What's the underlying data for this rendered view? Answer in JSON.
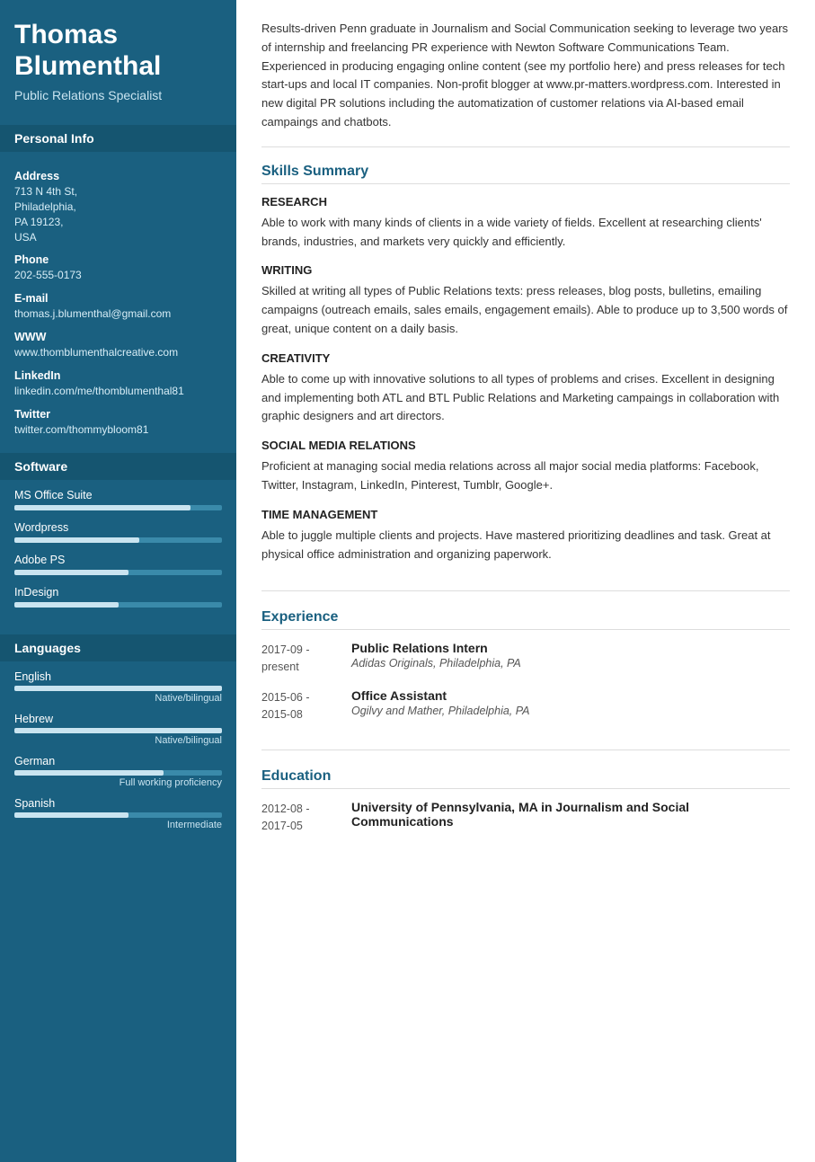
{
  "sidebar": {
    "name": "Thomas Blumenthal",
    "title": "Public Relations Specialist",
    "sections": {
      "personal_info": {
        "label": "Personal Info",
        "fields": [
          {
            "label": "Address",
            "value": "713 N 4th St,\nPhiladelphia,\nPA 19123,\nUSA"
          },
          {
            "label": "Phone",
            "value": "202-555-0173"
          },
          {
            "label": "E-mail",
            "value": "thomas.j.blumenthal@gmail.com"
          },
          {
            "label": "WWW",
            "value": "www.thomblumenthalcreative.com"
          },
          {
            "label": "LinkedIn",
            "value": "linkedin.com/me/thomblumenthal81"
          },
          {
            "label": "Twitter",
            "value": "twitter.com/thommybloom81"
          }
        ]
      },
      "software": {
        "label": "Software",
        "items": [
          {
            "name": "MS Office Suite",
            "pct": 85
          },
          {
            "name": "Wordpress",
            "pct": 60
          },
          {
            "name": "Adobe PS",
            "pct": 55
          },
          {
            "name": "InDesign",
            "pct": 50
          }
        ]
      },
      "languages": {
        "label": "Languages",
        "items": [
          {
            "name": "English",
            "pct": 100,
            "level": "Native/bilingual"
          },
          {
            "name": "Hebrew",
            "pct": 100,
            "level": "Native/bilingual"
          },
          {
            "name": "German",
            "pct": 72,
            "level": "Full working proficiency"
          },
          {
            "name": "Spanish",
            "pct": 55,
            "level": "Intermediate"
          }
        ]
      }
    }
  },
  "main": {
    "summary": "Results-driven Penn graduate in Journalism and Social Communication seeking to leverage two years of internship and freelancing PR experience with Newton Software Communications Team. Experienced in producing engaging online content (see my portfolio here) and press releases for tech start-ups and local IT companies. Non-profit blogger at www.pr-matters.wordpress.com. Interested in new digital PR solutions including the automatization of customer relations via AI-based email campaings and chatbots.",
    "skills_section_title": "Skills Summary",
    "skills": [
      {
        "name": "RESEARCH",
        "desc": "Able to work with many kinds of clients in a wide variety of fields. Excellent at researching clients' brands, industries, and markets very quickly and efficiently."
      },
      {
        "name": "WRITING",
        "desc": "Skilled at writing all types of Public Relations texts: press releases, blog posts, bulletins, emailing campaigns (outreach emails, sales emails, engagement emails). Able to produce up to 3,500 words of great, unique content on a daily basis."
      },
      {
        "name": "CREATIVITY",
        "desc": "Able to come up with innovative solutions to all types of problems and crises. Excellent in designing and implementing both ATL and BTL Public Relations and Marketing campaings in collaboration with graphic designers and art directors."
      },
      {
        "name": "SOCIAL MEDIA RELATIONS",
        "desc": "Proficient at managing social media relations across all major social media platforms: Facebook, Twitter, Instagram, LinkedIn, Pinterest, Tumblr, Google+."
      },
      {
        "name": "TIME MANAGEMENT",
        "desc": "Able to juggle multiple clients and projects. Have mastered prioritizing deadlines and task. Great at physical office administration and organizing paperwork."
      }
    ],
    "experience_section_title": "Experience",
    "experience": [
      {
        "date": "2017-09 - present",
        "role": "Public Relations Intern",
        "company": "Adidas Originals, Philadelphia, PA"
      },
      {
        "date": "2015-06 - 2015-08",
        "role": "Office Assistant",
        "company": "Ogilvy and Mather, Philadelphia, PA"
      }
    ],
    "education_section_title": "Education",
    "education": [
      {
        "date": "2012-08 - 2017-05",
        "role": "University of Pennsylvania, MA in Journalism and Social Communications",
        "company": ""
      }
    ]
  }
}
